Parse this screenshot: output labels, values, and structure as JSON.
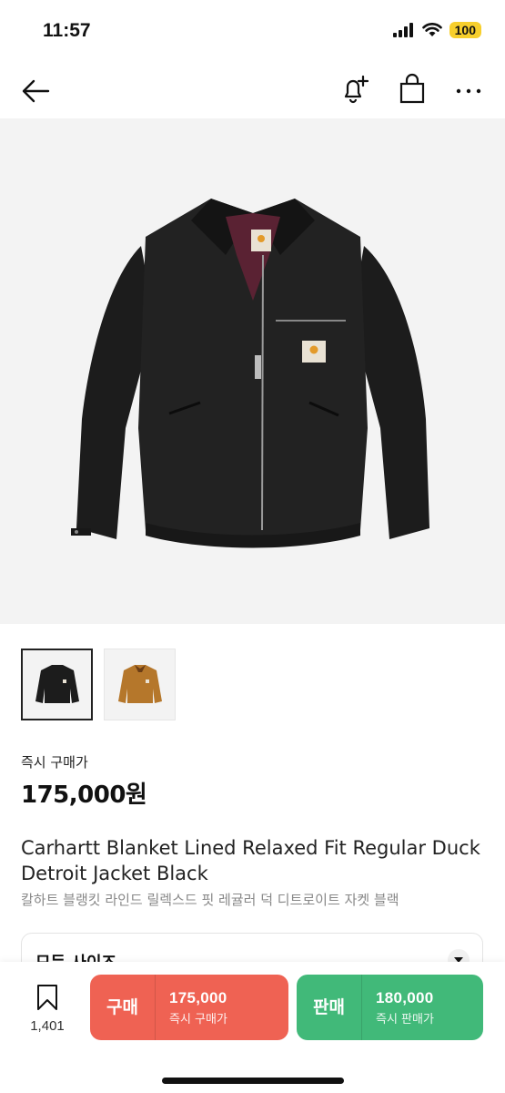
{
  "status": {
    "time": "11:57",
    "battery": "100",
    "icons": [
      "cellular-icon",
      "wifi-icon",
      "battery-icon"
    ]
  },
  "nav": {
    "icons": [
      "back-arrow-icon",
      "bell-plus-icon",
      "shopping-bag-icon",
      "more-icon"
    ]
  },
  "product": {
    "price_label": "즉시 구매가",
    "price": "175,000원",
    "title_en": "Carhartt Blanket Lined Relaxed Fit Regular Duck Detroit Jacket Black",
    "title_ko": "칼하트 블랭킷 라인드 릴렉스드 핏 레귤러 덕 디트로이트 자켓 블랙",
    "colors": {
      "black": "#1c1c1c",
      "brown": "#b5772b"
    }
  },
  "size_select": {
    "label": "모든 사이즈"
  },
  "bottom": {
    "wish_count": "1,401",
    "buy": {
      "kind": "구매",
      "price": "175,000",
      "sub": "즉시 구매가",
      "color": "#ef6253"
    },
    "sell": {
      "kind": "판매",
      "price": "180,000",
      "sub": "즉시 판매가",
      "color": "#41b979"
    }
  }
}
